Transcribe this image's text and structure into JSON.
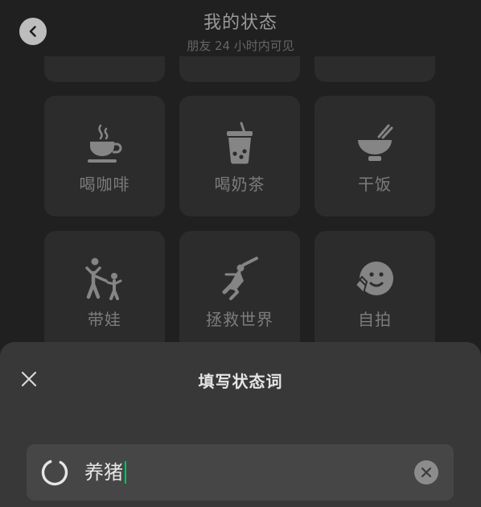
{
  "header": {
    "title": "我的状态",
    "subtitle": "朋友 24 小时内可见"
  },
  "grid": {
    "tiles": [
      {
        "label": "喝咖啡",
        "icon": "coffee-cup-icon"
      },
      {
        "label": "喝奶茶",
        "icon": "bubble-tea-icon"
      },
      {
        "label": "干饭",
        "icon": "rice-bowl-icon"
      },
      {
        "label": "带娃",
        "icon": "parent-child-icon"
      },
      {
        "label": "拯救世界",
        "icon": "superhero-icon"
      },
      {
        "label": "自拍",
        "icon": "selfie-icon"
      }
    ]
  },
  "sheet": {
    "title": "填写状态词",
    "input_value": "养猪"
  },
  "colors": {
    "background": "#202020",
    "tile": "#2c2c2c",
    "sheet": "#383838",
    "caret": "#07c160"
  }
}
